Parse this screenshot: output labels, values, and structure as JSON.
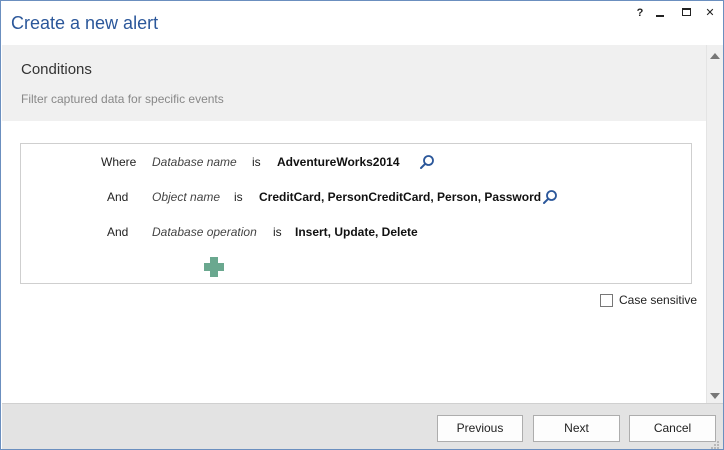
{
  "window": {
    "title": "Create a new alert",
    "help_label": "?",
    "close_label": "✕"
  },
  "header": {
    "title": "Conditions",
    "subtitle": "Filter captured data for specific events"
  },
  "conditions": [
    {
      "connector": "Where",
      "field": "Database name",
      "operator": "is",
      "value": "AdventureWorks2014",
      "has_search": true
    },
    {
      "connector": "And",
      "field": "Object name",
      "operator": "is",
      "value": "CreditCard, PersonCreditCard, Person, Password",
      "has_search": true
    },
    {
      "connector": "And",
      "field": "Database operation",
      "operator": "is",
      "value": "Insert, Update, Delete",
      "has_search": false
    }
  ],
  "options": {
    "case_sensitive_label": "Case sensitive",
    "case_sensitive_checked": false
  },
  "footer": {
    "previous_label": "Previous",
    "next_label": "Next",
    "cancel_label": "Cancel"
  },
  "icons": {
    "search": "search-icon",
    "add": "add-condition-icon"
  },
  "colors": {
    "title": "#2b579a",
    "add_icon": "#6aa88f",
    "search_icon": "#2b579a"
  }
}
